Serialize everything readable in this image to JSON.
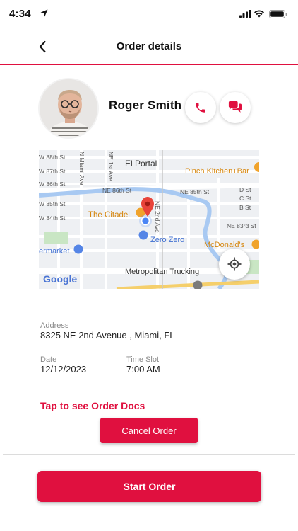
{
  "status_bar": {
    "time": "4:34",
    "icons": [
      "location-arrow-icon",
      "cellular-signal-icon",
      "wifi-icon",
      "battery-icon"
    ]
  },
  "navbar": {
    "title": "Order details",
    "back_icon": "chevron-left-icon"
  },
  "customer": {
    "name": "Roger Smith",
    "call_icon": "phone-icon",
    "chat_icon": "chat-bubbles-icon"
  },
  "map": {
    "labels": {
      "street_88th": "W 88th St",
      "street_87th": "W 87th St",
      "street_86th": "W 86th St",
      "street_85th": "W 85th St",
      "street_84th": "W 84th St",
      "miami_ave": "N Miami Ave",
      "ne_1st_ave": "NE 1st Ave",
      "ne_2nd_ave": "NE 2nd Ave",
      "el_portal": "El Portal",
      "pinch_kitchen": "Pinch Kitchen+Bar",
      "ne_86th": "NE 86th St",
      "ne_85th": "NE 85th St",
      "d_st": "D St",
      "c_st": "C St",
      "b_st": "B St",
      "ne_83rd": "NE 83rd St",
      "the_citadel": "The Citadel",
      "zero_zero": "Zero Zero",
      "mcdonalds": "McDonald's",
      "supermarket": "ermarket",
      "metropolitan": "Metropolitan Trucking",
      "google": "Google"
    },
    "locate_icon": "crosshair-locate-icon"
  },
  "address": {
    "label": "Address",
    "value": "8325 NE 2nd Avenue , Miami, FL"
  },
  "date": {
    "label": "Date",
    "value": "12/12/2023"
  },
  "time_slot": {
    "label": "Time Slot",
    "value": "7:00 AM"
  },
  "actions": {
    "docs_link": "Tap to see Order Docs",
    "cancel": "Cancel Order",
    "start": "Start Order"
  },
  "colors": {
    "accent": "#e0103f",
    "text": "#111111",
    "muted": "#8a8a8a"
  }
}
